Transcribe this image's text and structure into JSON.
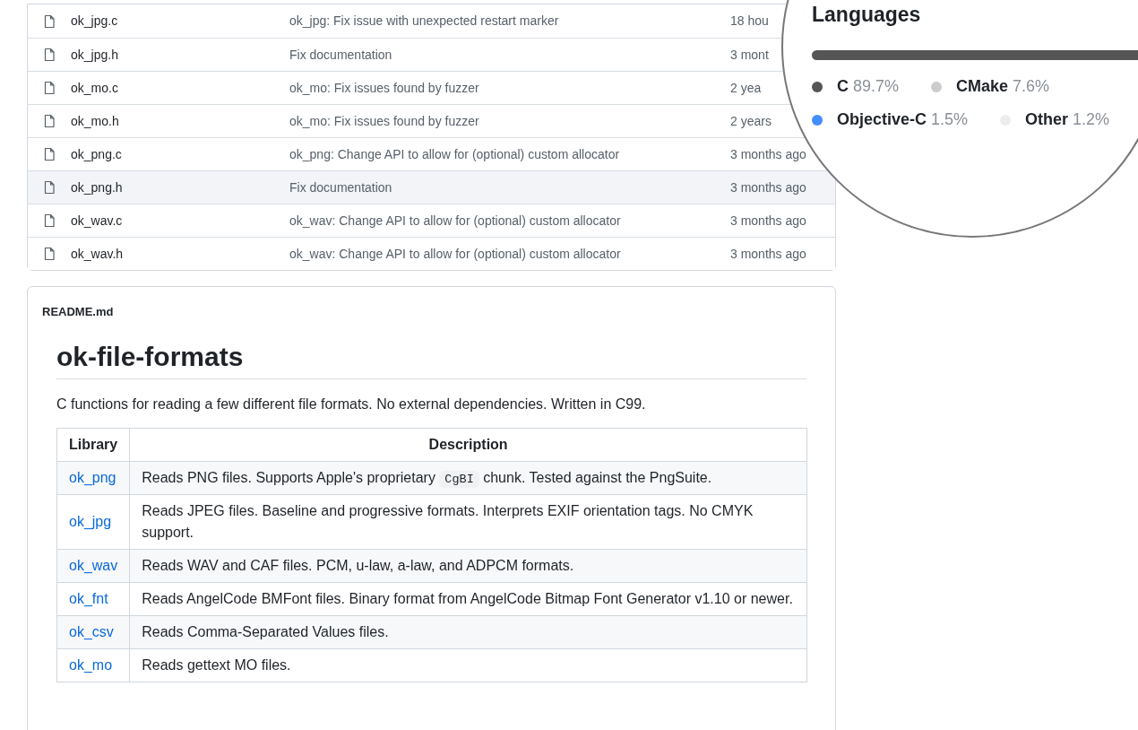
{
  "files": [
    {
      "name": "ok_jpg.c",
      "message": "ok_jpg: Fix issue with unexpected restart marker",
      "time": "18 hou",
      "hovered": false
    },
    {
      "name": "ok_jpg.h",
      "message": "Fix documentation",
      "time": "3 mont",
      "hovered": false
    },
    {
      "name": "ok_mo.c",
      "message": "ok_mo: Fix issues found by fuzzer",
      "time": "2 yea",
      "hovered": false
    },
    {
      "name": "ok_mo.h",
      "message": "ok_mo: Fix issues found by fuzzer",
      "time": "2 years",
      "hovered": false
    },
    {
      "name": "ok_png.c",
      "message": "ok_png: Change API to allow for (optional) custom allocator",
      "time": "3 months ago",
      "hovered": false
    },
    {
      "name": "ok_png.h",
      "message": "Fix documentation",
      "time": "3 months ago",
      "hovered": true
    },
    {
      "name": "ok_wav.c",
      "message": "ok_wav: Change API to allow for (optional) custom allocator",
      "time": "3 months ago",
      "hovered": false
    },
    {
      "name": "ok_wav.h",
      "message": "ok_wav: Change API to allow for (optional) custom allocator",
      "time": "3 months ago",
      "hovered": false
    }
  ],
  "readme": {
    "filename": "README.md",
    "title": "ok-file-formats",
    "intro": "C functions for reading a few different file formats. No external dependencies. Written in C99.",
    "table": {
      "columns": [
        "Library",
        "Description"
      ],
      "rows": [
        {
          "library": "ok_png",
          "description": [
            {
              "kind": "text",
              "text": "Reads PNG files. Supports Apple's proprietary"
            },
            {
              "kind": "code",
              "text": "CgBI"
            },
            {
              "kind": "text",
              "text": "chunk. Tested against the PngSuite."
            }
          ]
        },
        {
          "library": "ok_jpg",
          "description": "Reads JPEG files. Baseline and progressive formats. Interprets EXIF orientation tags. No CMYK support."
        },
        {
          "library": "ok_wav",
          "description": "Reads WAV and CAF files. PCM, u-law, a-law, and ADPCM formats."
        },
        {
          "library": "ok_fnt",
          "description": "Reads AngelCode BMFont files. Binary format from AngelCode Bitmap Font Generator v1.10 or newer."
        },
        {
          "library": "ok_csv",
          "description": "Reads Comma-Separated Values files."
        },
        {
          "library": "ok_mo",
          "description": "Reads gettext MO files."
        }
      ]
    }
  },
  "magnifier": {
    "title": "Languages",
    "languages": [
      {
        "name": "C",
        "percent": "89.7%",
        "color": "#555555"
      },
      {
        "name": "CMake",
        "percent": "7.6%",
        "color": "#cccccc"
      },
      {
        "name": "Objective-C",
        "percent": "1.5%",
        "color": "#438eff"
      },
      {
        "name": "Other",
        "percent": "1.2%",
        "color": "#ededed"
      }
    ]
  }
}
